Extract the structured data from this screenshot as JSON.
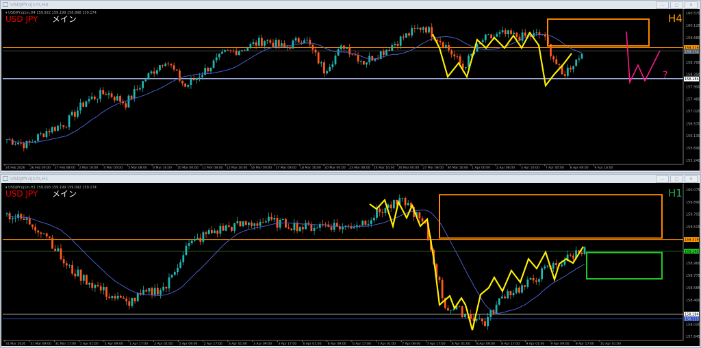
{
  "windows": [
    {
      "title": "USDJPY.oj1m,H4",
      "info": "USDJPY.oj1m,H4  159.922 159.199 158.898 159.174",
      "symbol": "USD JPY",
      "label": "メイン",
      "tf": "H4",
      "tf_color": "#ff9900",
      "price_labels": [
        {
          "p": 159.319,
          "t": "159.319",
          "bg": "#ff9900",
          "fg": "#000"
        },
        {
          "p": 159.174,
          "t": "159.174",
          "bg": "#506070",
          "fg": "#ccc"
        },
        {
          "p": 158.184,
          "t": "158.184",
          "bg": "#fff",
          "fg": "#000"
        }
      ]
    },
    {
      "title": "USDJPY.oj1m,H1",
      "info": "USDJPY.oj1m,H1  159.093 159.199 159.092 159.174",
      "symbol": "USD JPY",
      "label": "メイン",
      "tf": "H1",
      "tf_color": "#22aa55",
      "price_labels": [
        {
          "p": 159.319,
          "t": "159.319",
          "bg": "#ff9900",
          "fg": "#000"
        },
        {
          "p": 159.14,
          "t": "159.140",
          "bg": "#22cc22",
          "fg": "#000"
        },
        {
          "p": 158.184,
          "t": "158.184",
          "bg": "#fff",
          "fg": "#000"
        },
        {
          "p": 158.113,
          "t": "158.113",
          "bg": "#3050c0",
          "fg": "#ddd"
        }
      ]
    }
  ],
  "window_buttons": [
    "—",
    "▢",
    "✕"
  ],
  "chart_data": [
    {
      "type": "candlestick",
      "title": "USDJPY H4",
      "ylim": [
        155.09,
        160.67
      ],
      "yticks": [
        "160.570",
        "160.120",
        "159.680",
        "158.790",
        "158.350",
        "157.900",
        "157.460",
        "157.020",
        "156.570",
        "156.130",
        "155.690",
        "155.240"
      ],
      "xticks": [
        "24 Feb 2026",
        "26 Feb 00:00",
        "27 Feb 08:00",
        "2 Mar 16:00",
        "4 Mar 00:00",
        "5 Mar 08:00",
        "6 Mar 16:00",
        "10 Mar 00:00",
        "11 Mar 08:00",
        "12 Mar 16:00",
        "16 Mar 00:00",
        "17 Mar 08:00",
        "18 Mar 16:00",
        "20 Mar 00:00",
        "23 Mar 08:00",
        "24 Mar 16:00",
        "26 Mar 00:00",
        "27 Mar 08:00",
        "30 Mar 16:00",
        "1 Apr 00:00",
        "2 Apr 08:00",
        "3 Apr 16:00",
        "7 Apr 00:00",
        "8 Apr 08:00",
        "9 Apr 16:00"
      ],
      "closes": [
        156.0,
        155.8,
        156.3,
        156.6,
        157.4,
        157.7,
        157.3,
        158.2,
        158.9,
        157.9,
        158.5,
        159.1,
        159.3,
        159.6,
        159.3,
        159.7,
        158.5,
        159.4,
        158.8,
        159.2,
        159.7,
        160.1,
        159.5,
        158.6,
        159.6,
        159.8,
        159.7,
        159.8,
        158.3,
        159.1
      ],
      "hlines": [
        {
          "p": 159.319,
          "color": "#ff9900"
        },
        {
          "p": 159.2,
          "color": "#444"
        },
        {
          "p": 158.2,
          "color": "#ccc"
        },
        {
          "p": 158.17,
          "color": "#3050c0"
        }
      ],
      "boxes": [
        {
          "p1": 160.35,
          "p2": 159.38,
          "color": "#ff8800"
        }
      ],
      "ma_period": 20
    },
    {
      "type": "candlestick",
      "title": "USDJPY H1",
      "ylim": [
        157.783,
        160.148
      ],
      "yticks": [
        "160.075",
        "159.890",
        "159.705",
        "159.515",
        "158.960",
        "158.775",
        "158.585",
        "158.400",
        "158.030",
        "157.845"
      ],
      "xticks": [
        "31 Mar 2026",
        "31 Mar 09:00",
        "31 Mar 17:00",
        "1 Apr 01:00",
        "1 Apr 09:00",
        "1 Apr 17:00",
        "2 Apr 01:00",
        "2 Apr 09:00",
        "2 Apr 17:00",
        "3 Apr 01:00",
        "3 Apr 09:00",
        "3 Apr 17:00",
        "6 Apr 01:00",
        "6 Apr 09:00",
        "6 Apr 17:00",
        "7 Apr 01:00",
        "7 Apr 09:00",
        "7 Apr 17:00",
        "8 Apr 01:00",
        "8 Apr 09:00",
        "8 Apr 17:00",
        "9 Apr 01:00",
        "9 Apr 09:00",
        "9 Apr 17:00",
        "10 Apr 01:00"
      ],
      "closes": [
        159.7,
        159.6,
        159.4,
        158.9,
        158.7,
        158.5,
        158.35,
        158.5,
        158.6,
        159.2,
        159.4,
        159.5,
        159.55,
        159.6,
        159.55,
        159.5,
        159.55,
        159.5,
        159.6,
        159.8,
        159.9,
        159.5,
        158.3,
        158.2,
        158.05,
        158.5,
        158.6,
        158.85,
        159.0,
        159.2
      ],
      "hlines": [
        {
          "p": 159.319,
          "color": "#ff9900"
        },
        {
          "p": 159.14,
          "color": "#2a6a2a"
        },
        {
          "p": 158.184,
          "color": "#ccc"
        },
        {
          "p": 158.113,
          "color": "#3050c0"
        }
      ],
      "boxes": [
        {
          "p1": 160.0,
          "p2": 159.34,
          "color": "#ff8800"
        },
        {
          "p1": 159.12,
          "p2": 158.72,
          "color": "#22cc22"
        }
      ],
      "ma_period": 20
    }
  ],
  "annotation": {
    "question": "?"
  }
}
